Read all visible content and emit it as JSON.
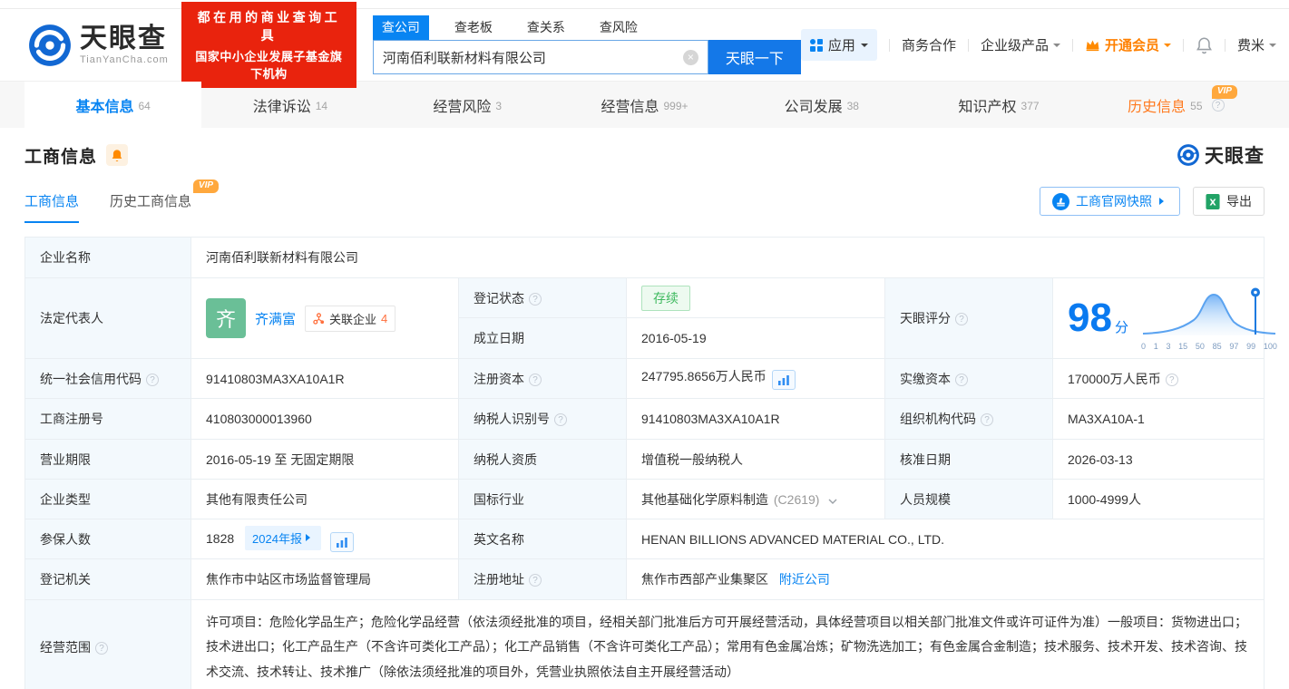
{
  "header": {
    "logo": {
      "title": "天眼查",
      "subtitle": "TianYanCha.com"
    },
    "banner": {
      "line1": "都在用的商业查询工具",
      "line2": "国家中小企业发展子基金旗下机构"
    },
    "search": {
      "tabs": [
        {
          "label": "查公司",
          "active": true
        },
        {
          "label": "查老板",
          "active": false
        },
        {
          "label": "查关系",
          "active": false
        },
        {
          "label": "查风险",
          "active": false
        }
      ],
      "value": "河南佰利联新材料有限公司",
      "button": "天眼一下"
    },
    "nav": {
      "apps": "应用",
      "cooperation": "商务合作",
      "enterprise": "企业级产品",
      "vip": "开通会员",
      "user": "费米"
    }
  },
  "tabs": [
    {
      "label": "基本信息",
      "count": "64",
      "active": true
    },
    {
      "label": "法律诉讼",
      "count": "14"
    },
    {
      "label": "经营风险",
      "count": "3"
    },
    {
      "label": "经营信息",
      "count": "999+"
    },
    {
      "label": "公司发展",
      "count": "38"
    },
    {
      "label": "知识产权",
      "count": "377"
    },
    {
      "label": "历史信息",
      "count": "55",
      "vip": "VIP"
    }
  ],
  "section": {
    "title": "工商信息",
    "watermark": "天眼查",
    "subtabs": [
      {
        "label": "工商信息",
        "active": true
      },
      {
        "label": "历史工商信息",
        "vip": "VIP"
      }
    ],
    "snapshot_button": "工商官网快照",
    "export_button": "导出"
  },
  "table": {
    "company_name": {
      "label": "企业名称",
      "value": "河南佰利联新材料有限公司"
    },
    "legal_rep": {
      "label": "法定代表人",
      "avatar_char": "齐",
      "name": "齐满富",
      "related_label": "关联企业",
      "related_count": "4"
    },
    "reg_status": {
      "label": "登记状态",
      "value": "存续"
    },
    "establish_date": {
      "label": "成立日期",
      "value": "2016-05-19"
    },
    "score_label": "天眼评分",
    "credit_code": {
      "label": "统一社会信用代码",
      "value": "91410803MA3XA10A1R"
    },
    "reg_capital": {
      "label": "注册资本",
      "value": "247795.8656万人民币"
    },
    "paid_capital": {
      "label": "实缴资本",
      "value": "170000万人民币"
    },
    "reg_number": {
      "label": "工商注册号",
      "value": "410803000013960"
    },
    "taxpayer_id": {
      "label": "纳税人识别号",
      "value": "91410803MA3XA10A1R"
    },
    "org_code": {
      "label": "组织机构代码",
      "value": "MA3XA10A-1"
    },
    "business_term": {
      "label": "营业期限",
      "value": "2016-05-19 至 无固定期限"
    },
    "taxpayer_quality": {
      "label": "纳税人资质",
      "value": "增值税一般纳税人"
    },
    "approval_date": {
      "label": "核准日期",
      "value": "2026-03-13"
    },
    "company_type": {
      "label": "企业类型",
      "value": "其他有限责任公司"
    },
    "industry": {
      "label": "国标行业",
      "value": "其他基础化学原料制造",
      "code": "(C2619)"
    },
    "staff_size": {
      "label": "人员规模",
      "value": "1000-4999人"
    },
    "insured": {
      "label": "参保人数",
      "value": "1828",
      "badge": "2024年报"
    },
    "english_name": {
      "label": "英文名称",
      "value": "HENAN BILLIONS ADVANCED MATERIAL CO., LTD."
    },
    "reg_authority": {
      "label": "登记机关",
      "value": "焦作市中站区市场监督管理局"
    },
    "reg_address": {
      "label": "注册地址",
      "value": "焦作市西部产业集聚区",
      "nearby": "附近公司"
    },
    "business_scope": {
      "label": "经营范围",
      "value": "许可项目：危险化学品生产；危险化学品经营（依法须经批准的项目，经相关部门批准后方可开展经营活动，具体经营项目以相关部门批准文件或许可证件为准）一般项目：货物进出口；技术进出口；化工产品生产（不含许可类化工产品）；化工产品销售（不含许可类化工产品）；常用有色金属冶炼；矿物洗选加工；有色金属合金制造；技术服务、技术开发、技术咨询、技术交流、技术转让、技术推广（除依法须经批准的项目外，凭营业执照依法自主开展经营活动）"
    }
  },
  "score_chart": {
    "type": "area",
    "score": "98",
    "unit": "分",
    "marker_value": 98,
    "ticks": [
      "0",
      "1",
      "3",
      "15",
      "50",
      "85",
      "97",
      "99",
      "100"
    ],
    "curve_color": "#5ba3f0",
    "accent_color": "#0884f2"
  },
  "colors": {
    "accent": "#0884f2",
    "banner_red": "#e9230d",
    "vip_orange": "#ff8a00",
    "status_green": "#3fb95f"
  }
}
